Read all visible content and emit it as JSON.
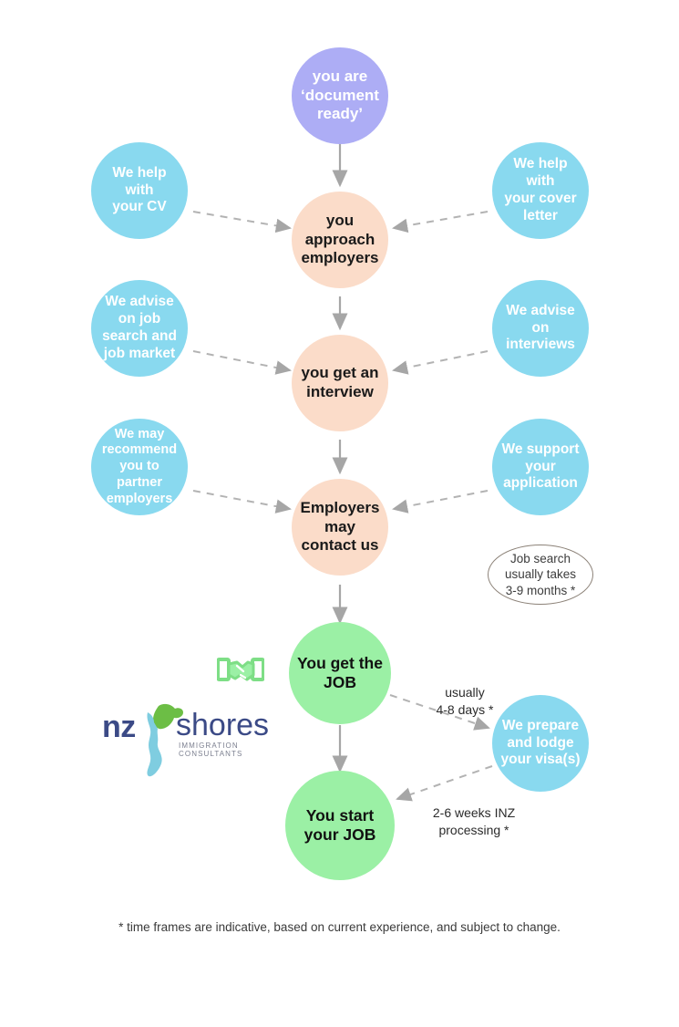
{
  "diagram": {
    "title": "Job search and visa process flow",
    "colors": {
      "purple": "#adadf5",
      "blue": "#89d9ef",
      "peach": "#fbdcc9",
      "green": "#9bf0a5",
      "arrow": "#a6a6a6",
      "logo_navy": "#3b4a86",
      "logo_green": "#6cbe45",
      "logo_blue": "#7fcde0"
    },
    "nodes": [
      {
        "id": "document-ready",
        "label": "you are\n‘document\nready’",
        "type": "purple"
      },
      {
        "id": "help-cv",
        "label": "We help with\nyour CV",
        "type": "blue"
      },
      {
        "id": "approach-employers",
        "label": "you\napproach\nemployers",
        "type": "peach"
      },
      {
        "id": "help-cover-letter",
        "label": "We help with\nyour cover\nletter",
        "type": "blue"
      },
      {
        "id": "advise-job-search",
        "label": "We advise\non job\nsearch and\njob market",
        "type": "blue"
      },
      {
        "id": "get-interview",
        "label": "you get an\ninterview",
        "type": "peach"
      },
      {
        "id": "advise-interviews",
        "label": "We advise\non\ninterviews",
        "type": "blue"
      },
      {
        "id": "recommend-partner-employers",
        "label": "We may\nrecommend\nyou to\npartner\nemployers",
        "type": "blue"
      },
      {
        "id": "employers-contact-us",
        "label": "Employers\nmay\ncontact us",
        "type": "peach"
      },
      {
        "id": "support-application",
        "label": "We support\nyour\napplication",
        "type": "blue"
      },
      {
        "id": "get-job",
        "label": "You get the\nJOB",
        "type": "green"
      },
      {
        "id": "prepare-lodge-visa",
        "label": "We prepare\nand lodge\nyour visa(s)",
        "type": "blue"
      },
      {
        "id": "start-job",
        "label": "You start\nyour JOB",
        "type": "green"
      }
    ],
    "callout": {
      "id": "job-search-duration",
      "label": "Job search\nusually takes\n3-9 months *"
    },
    "edge_labels": [
      {
        "id": "visa-prep-duration",
        "label": "usually\n4-8 days *"
      },
      {
        "id": "inz-processing-duration",
        "label": "2-6 weeks INZ\nprocessing *"
      }
    ],
    "footnote": "*  time frames are indicative, based on current experience, and subject to change.",
    "logo": {
      "word_mark_left": "nz",
      "word_mark_right": "shores",
      "tagline": "IMMIGRATION CONSULTANTS"
    }
  }
}
